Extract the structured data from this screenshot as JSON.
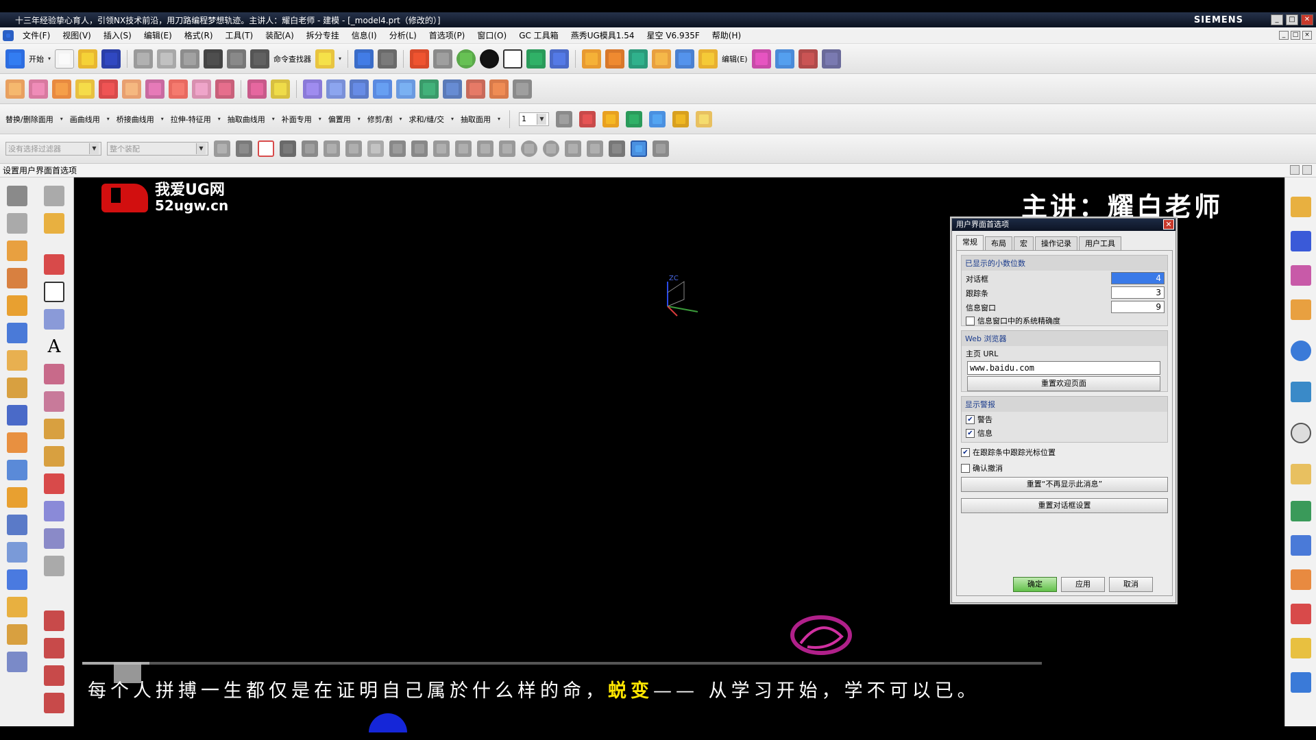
{
  "window": {
    "title": "十三年经验挚心育人，引领NX技术前沿，用刀路编程梦想轨迹。主讲人：耀白老师 - 建模 - [_model4.prt（修改的）]",
    "brand": "SIEMENS"
  },
  "menubar": {
    "items": [
      "文件(F)",
      "视图(V)",
      "插入(S)",
      "编辑(E)",
      "格式(R)",
      "工具(T)",
      "装配(A)",
      "拆分专挂",
      "信息(I)",
      "分析(L)",
      "首选项(P)",
      "窗口(O)",
      "GC 工具箱",
      "燕秀UG模具1.54",
      "星空 V6.935F",
      "帮助(H)"
    ]
  },
  "toolbar1": {
    "start_label": "开始",
    "cmd_finder_label": "命令查找器",
    "edit_label": "编辑(E)"
  },
  "toolbar3": {
    "items": [
      "替换/删除面用",
      "画曲线用",
      "桥接曲线用",
      "拉伸-特征用",
      "抽取曲线用",
      "补面专用",
      "偏置用",
      "修剪/割",
      "求和/缝/交",
      "抽取面用"
    ],
    "layer_value": "1"
  },
  "toolbar4": {
    "filter_placeholder": "没有选择过滤器",
    "assembly_placeholder": "整个装配"
  },
  "cue_line": "设置用户界面首选项",
  "overlay": {
    "logo_line1": "我爱UG网",
    "logo_line2": "52ugw.cn",
    "lecturer": "主讲：耀白老师",
    "subtitle_before": "每个人拼搏一生都仅是在证明自己属於什么样的命，",
    "subtitle_highlight": "蜕变",
    "subtitle_after": "—— 从学习开始，学不可以已。",
    "progress": 0.07,
    "triad_label": "ZC"
  },
  "dialog": {
    "title": "用户界面首选项",
    "tabs": [
      "常规",
      "布局",
      "宏",
      "操作记录",
      "用户工具"
    ],
    "active_tab": "常规",
    "decimal_group": {
      "header": "已显示的小数位数",
      "dialog_label": "对话框",
      "dialog_value": "4",
      "tracking_label": "跟踪条",
      "tracking_value": "3",
      "info_label": "信息窗口",
      "info_value": "9",
      "sys_precision_label": "信息窗口中的系统精确度",
      "sys_precision_checked": false
    },
    "web_group": {
      "header": "Web 浏览器",
      "home_label": "主页 URL",
      "home_url": "www.baidu.com",
      "reset_welcome": "重置欢迎页面"
    },
    "alert_group": {
      "header": "显示警报",
      "warning_label": "警告",
      "warning_checked": true,
      "info_label": "信息",
      "info_checked": true
    },
    "track_cursor_label": "在跟踪条中跟踪光标位置",
    "track_cursor_checked": true,
    "confirm_undo_label": "确认撤消",
    "confirm_undo_checked": false,
    "reset_dont_show": "重置“不再显示此消息”",
    "reset_dialog_settings": "重置对话框设置",
    "ok": "确定",
    "apply": "应用",
    "cancel": "取消"
  },
  "colors": {
    "accent_blue": "#3a7ae8",
    "ok_green": "#62c04a",
    "close_red": "#c8392b",
    "logo_red": "#d20f0f",
    "subtitle_highlight": "#ffe600"
  }
}
